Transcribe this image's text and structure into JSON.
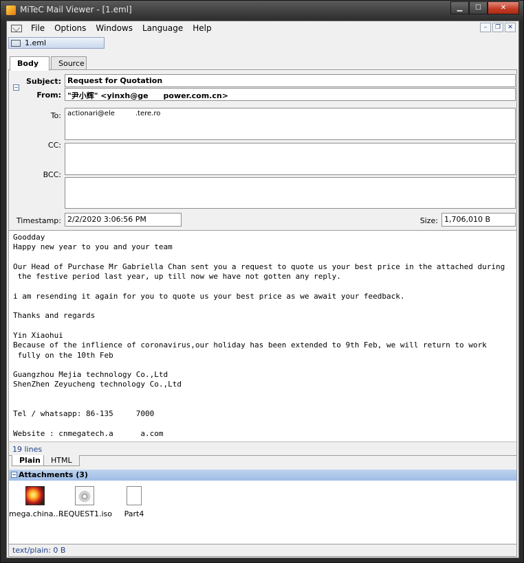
{
  "window": {
    "title": "MiTeC Mail Viewer - [1.eml]",
    "minimize": "▁",
    "maximize": "☐",
    "close": "✕"
  },
  "menu": {
    "items": [
      "File",
      "Options",
      "Windows",
      "Language",
      "Help"
    ],
    "mdi_minimize": "–",
    "mdi_restore": "❐",
    "mdi_close": "✕"
  },
  "document_tab": {
    "label": "1.eml",
    "icon": "envelope-icon"
  },
  "view_tabs": [
    "Body",
    "Source"
  ],
  "header": {
    "subject_label": "Subject:",
    "subject": "Request for Quotation",
    "from_label": "From:",
    "from": "\"尹小辉\" <yinxh@ge  power.com.cn>",
    "to_label": "To:",
    "to": "actionari@ele   .tere.ro",
    "cc_label": "CC:",
    "cc": "",
    "bcc_label": "BCC:",
    "bcc": "",
    "timestamp_label": "Timestamp:",
    "timestamp": "2/2/2020 3:06:56 PM",
    "size_label": "Size:",
    "size": "1,706,010 B",
    "collapse_glyph": "−"
  },
  "body": {
    "text": "Goodday\nHappy new year to you and your team\n\nOur Head of Purchase Mr Gabriella Chan sent you a request to quote us your best price in the attached during\n the festive period last year, up till now we have not gotten any reply.\n\ni am resending it again for you to quote us your best price as we await your feedback.\n\nThanks and regards\n\nYin Xiaohui\nBecause of the inflience of coronavirus,our holiday has been extended to 9th Feb, we will return to work\n fully on the 10th Feb\n\nGuangzhou Mejia technology Co.,Ltd\nShenZhen Zeyucheng technology Co.,Ltd\n\n\nTel / whatsapp: 86-135     7000\n\nWebsite : cnmegatech.a      a.com",
    "lines_count": "19 lines"
  },
  "format_tabs": [
    "Plain",
    "HTML"
  ],
  "attachments": {
    "header": "Attachments (3)",
    "items": [
      {
        "name": "mega.china....",
        "icon": "image-file-icon"
      },
      {
        "name": "REQUEST1.iso",
        "icon": "disc-image-icon"
      },
      {
        "name": "Part4",
        "icon": "blank-file-icon"
      }
    ]
  },
  "status": {
    "text": "text/plain: 0 B"
  }
}
